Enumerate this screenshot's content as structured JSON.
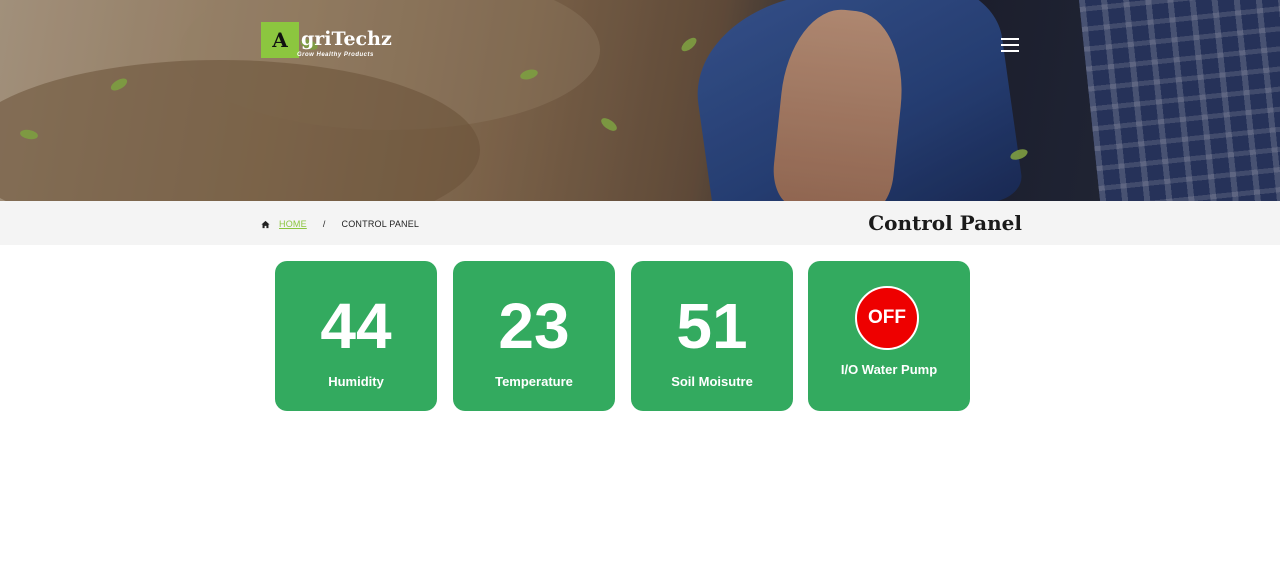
{
  "header": {
    "logo_letter": "A",
    "logo_name": "griTechz",
    "logo_tagline": "Grow Healthy Products",
    "menu_icon": "hamburger-menu-icon"
  },
  "breadcrumb": {
    "home_icon": "home-icon",
    "home_label": "HOME",
    "separator": "/",
    "current": "CONTROL PANEL"
  },
  "page": {
    "title": "Control Panel"
  },
  "cards": [
    {
      "value": "44",
      "label": "Humidity"
    },
    {
      "value": "23",
      "label": "Temperature"
    },
    {
      "value": "51",
      "label": "Soil Moisutre"
    }
  ],
  "pump": {
    "state": "OFF",
    "label": "I/O Water Pump"
  },
  "colors": {
    "accent": "#8cc63f",
    "card_green": "#33aa5f",
    "pump_off": "#ee0000"
  }
}
